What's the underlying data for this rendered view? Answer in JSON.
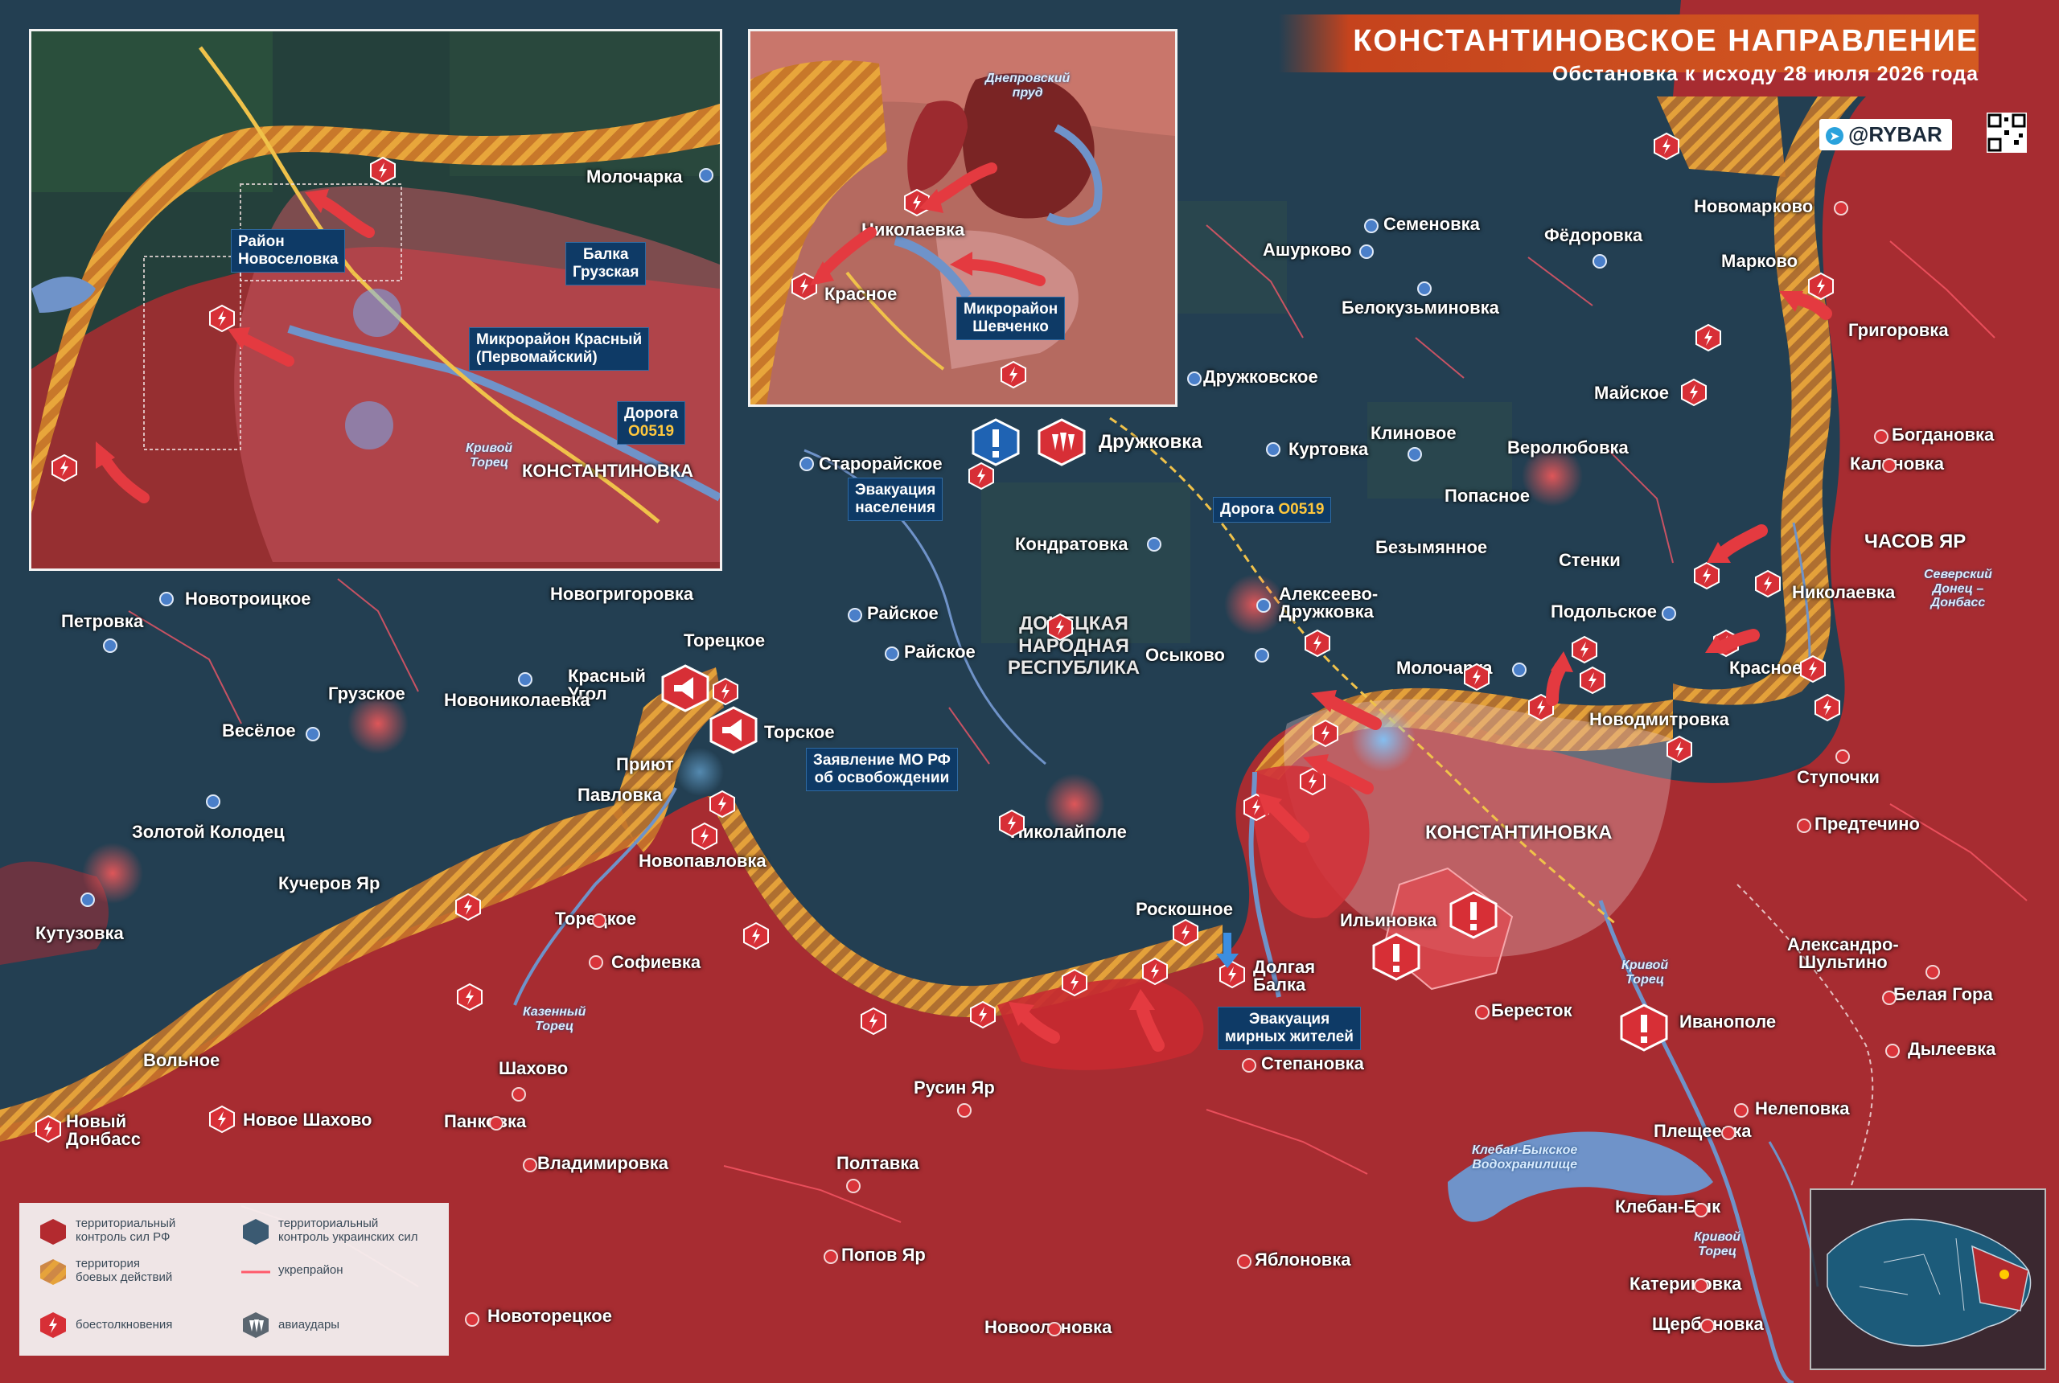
{
  "header": {
    "title": "КОНСТАНТИНОВСКОЕ НАПРАВЛЕНИЕ",
    "subtitle": "Обстановка к исходу 28 июля 2026 года",
    "brand": "@RYBAR"
  },
  "colors": {
    "ru_control": "#b32a2f",
    "ua_control": "#233f52",
    "combat_zone": "#d98a2b",
    "water": "#6f93c9",
    "header_orange": "#d45a21",
    "callout_blue": "#0e3a66",
    "fortification": "#ff5a6a"
  },
  "region_label": "ДОНЕЦКАЯ НАРОДНАЯ РЕСПУБЛИКА",
  "places": {
    "molocharka": "Молочарка",
    "semenovka": "Семеновка",
    "ashurkovo": "Ашурково",
    "fedorovka": "Фёдоровка",
    "novomarkovo": "Новомарково",
    "markovo": "Марково",
    "grigorovka": "Григоровка",
    "belokuzminovka": "Белокузьминовка",
    "druzhkovskoe": "Дружковское",
    "maiskoe": "Майское",
    "bogdanovka": "Богдановка",
    "kalinovka": "Калиновка",
    "druzhkovka": "Дружковка",
    "klinovoe": "Клиновое",
    "kurtovka": "Куртовка",
    "verolyubovka": "Веролюбовка",
    "starorayskoe": "Старорайское",
    "popasnoe": "Попасное",
    "kondratovka": "Кондратовка",
    "bezymyannoe": "Безымянное",
    "chasov_yar": "ЧАСОВ ЯР",
    "stenki": "Стенки",
    "nikolaevka": "Николаевка",
    "petrovka": "Петровка",
    "novotroitskoe": "Новотроицкое",
    "novogrigorovka": "Новогригоровка",
    "rayskoe1": "Райское",
    "rayskoe2": "Райское",
    "alekseevo": "Алексеево-\nДружковка",
    "podolskoe": "Подольское",
    "toretskoe1": "Торецкое",
    "osykovo": "Осыково",
    "molocharka2": "Молочарка",
    "krasnoe": "Красное",
    "gruzskoe": "Грузское",
    "krasny_ugol": "Красный\nУгол",
    "novonikolaevka": "Новониколаевка",
    "torskoe": "Торское",
    "novodmitrovka": "Новодмитровка",
    "veseloe": "Весёлое",
    "priyut": "Приют",
    "pavlovka": "Павловка",
    "stupochki": "Ступочки",
    "zolotoy_kolodets": "Золотой Колодец",
    "nikolaypole": "Николайполе",
    "konstantinovka": "КОНСТАНТИНОВКА",
    "predtechino": "Предтечино",
    "novopavlovka": "Новопавловка",
    "kucherov_yar": "Кучеров Яр",
    "roskoshnoe": "Роскошное",
    "ilinovka": "Ильиновка",
    "kutuzovka": "Кутузовка",
    "toretskoe2": "Торецкое",
    "aleksandro": "Александро-\nШультино",
    "sofievka": "Софиевка",
    "dolgaya_balka": "Долгая\nБалка",
    "belaya_gora": "Белая Гора",
    "berestok": "Бересток",
    "ivanopole": "Иванополе",
    "dyleevka": "Дылеевка",
    "volnoe": "Вольное",
    "stepanovka": "Степановка",
    "shakhovo": "Шахово",
    "rusin_yar": "Русин Яр",
    "nelepovka": "Нелеповка",
    "novy_donbass": "Новый\nДонбасс",
    "novoe_shakhovo": "Новое Шахово",
    "pankovka": "Панковка",
    "pleshcheevka": "Плещеевка",
    "vladimirovka": "Владимировка",
    "poltavka": "Полтавка",
    "kleban_byk": "Клебан-Бык",
    "popov_yar": "Попов Яр",
    "yablonovka": "Яблоновка",
    "katerinovka": "Катериновка",
    "novotoretskoe": "Новоторецкое",
    "novoolenovka": "Новооленовка",
    "shcherbinovka": "Щербиновка"
  },
  "water_labels": {
    "seversky_donets": "Северский\nДонец –\nДонбасс",
    "kazenny_torets": "Казенный\nТорец",
    "krivoy_torets1": "Кривой\nТорец",
    "krivoy_torets2": "Кривой\nТорец",
    "kleban_reservoir": "Клебан-Быкское\nВодохранилище"
  },
  "callouts": {
    "evacuation": "Эвакуация\nнаселения",
    "road_main": "Дорога",
    "road_code": "О0519",
    "mo_statement": "Заявление МО РФ\nоб освобождении",
    "evacuation_civ": "Эвакуация\nмирных жителей"
  },
  "inset_left": {
    "places": {
      "molocharka": "Молочарка",
      "konstantinovka": "КОНСТАНТИНОВКА"
    },
    "callouts": {
      "novoselovka": "Район\nНовоселовка",
      "gruzskaya": "Балка\nГрузская",
      "krasny": "Микрорайон Красный\n(Первомайский)",
      "road": "Дорога",
      "road_code": "О0519"
    },
    "water": "Кривой\nТорец"
  },
  "inset_right": {
    "places": {
      "nikolaevka": "Николаевка",
      "krasnoe": "Красное"
    },
    "callouts": {
      "shevchenko": "Микрорайон\nШевченко"
    },
    "water": "Днепровский\nпруд"
  },
  "legend": {
    "ru": "территориальный\nконтроль сил РФ",
    "ua": "территориальный\nконтроль украинских сил",
    "combat": "территория\nбоевых действий",
    "fort": "укрепрайон",
    "clashes": "боестолкновения",
    "airstrikes": "авиаудары"
  }
}
